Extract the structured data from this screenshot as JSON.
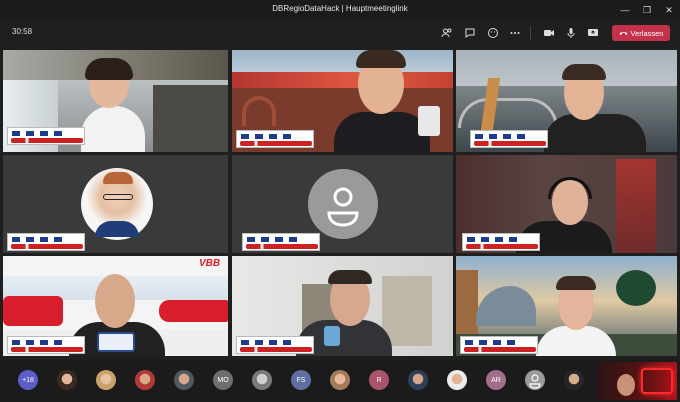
{
  "window": {
    "title": "DBRegioDataHack | Hauptmeetinglink"
  },
  "toolbar": {
    "timer": "30:58",
    "leave_label": "Verlassen",
    "icons": [
      "people-icon",
      "chat-icon",
      "reactions-icon",
      "more-icon",
      "camera-icon",
      "mic-icon",
      "share-icon"
    ]
  },
  "tiles": [
    {
      "id": "p1",
      "kind": "video"
    },
    {
      "id": "p2",
      "kind": "video"
    },
    {
      "id": "p3",
      "kind": "video"
    },
    {
      "id": "p4",
      "kind": "avatar-photo"
    },
    {
      "id": "p5",
      "kind": "placeholder"
    },
    {
      "id": "p6",
      "kind": "video"
    },
    {
      "id": "p7",
      "kind": "video",
      "background_text": "VBB"
    },
    {
      "id": "p8",
      "kind": "video"
    },
    {
      "id": "p9",
      "kind": "video"
    }
  ],
  "participants_bar": {
    "overflow_count": "+18",
    "initials": [
      "MO",
      "FS",
      "R",
      "AR"
    ]
  },
  "colors": {
    "leave": "#c4314b",
    "overflow": "#5b5fc7"
  }
}
